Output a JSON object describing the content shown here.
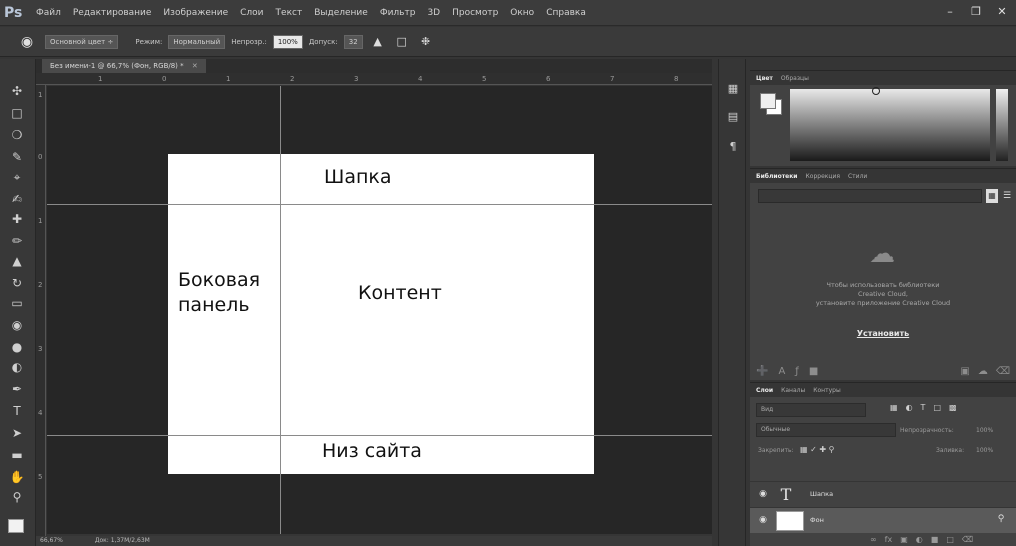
{
  "app": {
    "logo": "Ps"
  },
  "menu": [
    "Файл",
    "Редактирование",
    "Изображение",
    "Слои",
    "Текст",
    "Выделение",
    "Фильтр",
    "3D",
    "Просмотр",
    "Окно",
    "Справка"
  ],
  "window_controls": {
    "minimize": "–",
    "restore": "❐",
    "close": "✕"
  },
  "options": {
    "source_select": "Основной цвет ÷",
    "mode_label": "Режим:",
    "mode_value": "Нормальный",
    "opacity_label": "Непрозр.:",
    "opacity_value": "100%",
    "tolerance_label": "Допуск:",
    "tolerance_value": "32"
  },
  "document": {
    "tab_title": "Без имени-1 @ 66,7% (Фон, RGB/8) *",
    "tab_close": "✕",
    "zoom": "66,67%",
    "doc_size": "Док: 1,37M/2,63M"
  },
  "ruler": {
    "top_ticks": [
      "1",
      "0",
      "1",
      "2",
      "3",
      "4",
      "5",
      "6",
      "7",
      "8"
    ],
    "left_ticks": [
      "1",
      "0",
      "1",
      "2",
      "3",
      "4",
      "5"
    ]
  },
  "canvas_text": {
    "header": "Шапка",
    "sidebar_line1": "Боковая",
    "sidebar_line2": "панель",
    "content": "Контент",
    "footer": "Низ сайта"
  },
  "color_panel": {
    "tabs": [
      "Цвет",
      "Образцы"
    ]
  },
  "libraries_panel": {
    "tabs": [
      "Библиотеки",
      "Коррекция",
      "Стили"
    ],
    "message_line1": "Чтобы использовать библиотеки",
    "message_line2": "Creative Cloud,",
    "message_line3": "установите приложение Creative Cloud",
    "install_link": "Установить"
  },
  "layers_panel": {
    "tabs": [
      "Слои",
      "Каналы",
      "Контуры"
    ],
    "filter": "Вид",
    "blend_mode": "Обычные",
    "opacity_label": "Непрозрачность:",
    "opacity_value": "100%",
    "lock_label": "Закрепить:",
    "fill_label": "Заливка:",
    "fill_value": "100%",
    "layers": [
      {
        "name": "Шапка",
        "type": "text"
      },
      {
        "name": "Фон",
        "type": "background"
      }
    ]
  },
  "icons": {
    "tool_icons": [
      "move-icon",
      "marquee-icon",
      "lasso-icon",
      "quick-select-icon",
      "crop-icon",
      "eyedropper-icon",
      "healing-icon",
      "brush-icon",
      "stamp-icon",
      "history-brush-icon",
      "eraser-icon",
      "paint-bucket-icon",
      "blur-icon",
      "dodge-icon",
      "pen-icon",
      "type-icon",
      "path-select-icon",
      "shape-icon",
      "hand-icon",
      "zoom-icon"
    ]
  }
}
